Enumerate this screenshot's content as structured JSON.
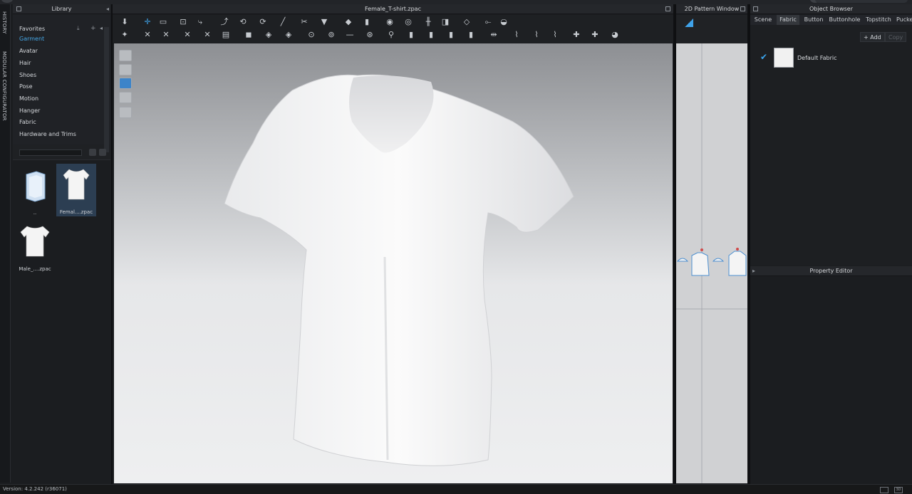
{
  "side_tabs": [
    "HISTORY",
    "MODULAR CONFIGURATOR"
  ],
  "library": {
    "title": "Library",
    "items": [
      "Favorites",
      "Garment",
      "Avatar",
      "Hair",
      "Shoes",
      "Pose",
      "Motion",
      "Hanger",
      "Fabric",
      "Hardware and Trims"
    ],
    "active": "Garment",
    "files": [
      {
        "label": "..",
        "icon": "folder-icon"
      },
      {
        "label": "Femal....zpac",
        "icon": "female-tshirt-icon"
      },
      {
        "label": "Male_....zpac",
        "icon": "male-tshirt-icon"
      }
    ]
  },
  "viewport": {
    "title": "Female_T-shirt.zpac"
  },
  "pattern_window": {
    "title": "2D Pattern Window"
  },
  "object_browser": {
    "title": "Object Browser",
    "tabs": [
      "Scene",
      "Fabric",
      "Button",
      "Buttonhole",
      "Topstitch",
      "Pucke"
    ],
    "active_tab": "Fabric",
    "add_label": "+ Add",
    "copy_label": "Copy",
    "fabric_name": "Default Fabric"
  },
  "property_editor": {
    "title": "Property Editor"
  },
  "status": {
    "version": "Version: 4.2.242 (r36071)",
    "view_3d": "3D"
  },
  "colors": {
    "accent": "#3fa3ea",
    "selected_thumb": "#2c3e52"
  }
}
